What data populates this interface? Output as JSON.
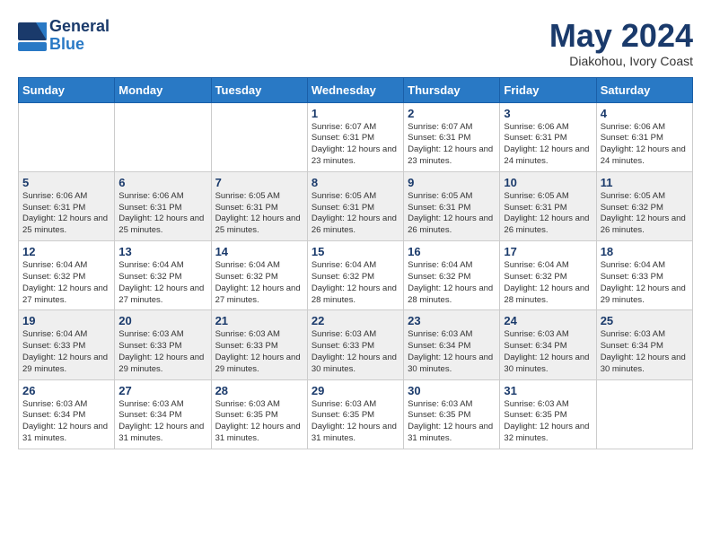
{
  "logo": {
    "general": "General",
    "blue": "Blue"
  },
  "title": {
    "month": "May 2024",
    "location": "Diakohou, Ivory Coast"
  },
  "weekdays": [
    "Sunday",
    "Monday",
    "Tuesday",
    "Wednesday",
    "Thursday",
    "Friday",
    "Saturday"
  ],
  "rows": [
    {
      "shaded": false,
      "cells": [
        {
          "day": "",
          "sunrise": "",
          "sunset": "",
          "daylight": ""
        },
        {
          "day": "",
          "sunrise": "",
          "sunset": "",
          "daylight": ""
        },
        {
          "day": "",
          "sunrise": "",
          "sunset": "",
          "daylight": ""
        },
        {
          "day": "1",
          "sunrise": "Sunrise: 6:07 AM",
          "sunset": "Sunset: 6:31 PM",
          "daylight": "Daylight: 12 hours and 23 minutes."
        },
        {
          "day": "2",
          "sunrise": "Sunrise: 6:07 AM",
          "sunset": "Sunset: 6:31 PM",
          "daylight": "Daylight: 12 hours and 23 minutes."
        },
        {
          "day": "3",
          "sunrise": "Sunrise: 6:06 AM",
          "sunset": "Sunset: 6:31 PM",
          "daylight": "Daylight: 12 hours and 24 minutes."
        },
        {
          "day": "4",
          "sunrise": "Sunrise: 6:06 AM",
          "sunset": "Sunset: 6:31 PM",
          "daylight": "Daylight: 12 hours and 24 minutes."
        }
      ]
    },
    {
      "shaded": true,
      "cells": [
        {
          "day": "5",
          "sunrise": "Sunrise: 6:06 AM",
          "sunset": "Sunset: 6:31 PM",
          "daylight": "Daylight: 12 hours and 25 minutes."
        },
        {
          "day": "6",
          "sunrise": "Sunrise: 6:06 AM",
          "sunset": "Sunset: 6:31 PM",
          "daylight": "Daylight: 12 hours and 25 minutes."
        },
        {
          "day": "7",
          "sunrise": "Sunrise: 6:05 AM",
          "sunset": "Sunset: 6:31 PM",
          "daylight": "Daylight: 12 hours and 25 minutes."
        },
        {
          "day": "8",
          "sunrise": "Sunrise: 6:05 AM",
          "sunset": "Sunset: 6:31 PM",
          "daylight": "Daylight: 12 hours and 26 minutes."
        },
        {
          "day": "9",
          "sunrise": "Sunrise: 6:05 AM",
          "sunset": "Sunset: 6:31 PM",
          "daylight": "Daylight: 12 hours and 26 minutes."
        },
        {
          "day": "10",
          "sunrise": "Sunrise: 6:05 AM",
          "sunset": "Sunset: 6:31 PM",
          "daylight": "Daylight: 12 hours and 26 minutes."
        },
        {
          "day": "11",
          "sunrise": "Sunrise: 6:05 AM",
          "sunset": "Sunset: 6:32 PM",
          "daylight": "Daylight: 12 hours and 26 minutes."
        }
      ]
    },
    {
      "shaded": false,
      "cells": [
        {
          "day": "12",
          "sunrise": "Sunrise: 6:04 AM",
          "sunset": "Sunset: 6:32 PM",
          "daylight": "Daylight: 12 hours and 27 minutes."
        },
        {
          "day": "13",
          "sunrise": "Sunrise: 6:04 AM",
          "sunset": "Sunset: 6:32 PM",
          "daylight": "Daylight: 12 hours and 27 minutes."
        },
        {
          "day": "14",
          "sunrise": "Sunrise: 6:04 AM",
          "sunset": "Sunset: 6:32 PM",
          "daylight": "Daylight: 12 hours and 27 minutes."
        },
        {
          "day": "15",
          "sunrise": "Sunrise: 6:04 AM",
          "sunset": "Sunset: 6:32 PM",
          "daylight": "Daylight: 12 hours and 28 minutes."
        },
        {
          "day": "16",
          "sunrise": "Sunrise: 6:04 AM",
          "sunset": "Sunset: 6:32 PM",
          "daylight": "Daylight: 12 hours and 28 minutes."
        },
        {
          "day": "17",
          "sunrise": "Sunrise: 6:04 AM",
          "sunset": "Sunset: 6:32 PM",
          "daylight": "Daylight: 12 hours and 28 minutes."
        },
        {
          "day": "18",
          "sunrise": "Sunrise: 6:04 AM",
          "sunset": "Sunset: 6:33 PM",
          "daylight": "Daylight: 12 hours and 29 minutes."
        }
      ]
    },
    {
      "shaded": true,
      "cells": [
        {
          "day": "19",
          "sunrise": "Sunrise: 6:04 AM",
          "sunset": "Sunset: 6:33 PM",
          "daylight": "Daylight: 12 hours and 29 minutes."
        },
        {
          "day": "20",
          "sunrise": "Sunrise: 6:03 AM",
          "sunset": "Sunset: 6:33 PM",
          "daylight": "Daylight: 12 hours and 29 minutes."
        },
        {
          "day": "21",
          "sunrise": "Sunrise: 6:03 AM",
          "sunset": "Sunset: 6:33 PM",
          "daylight": "Daylight: 12 hours and 29 minutes."
        },
        {
          "day": "22",
          "sunrise": "Sunrise: 6:03 AM",
          "sunset": "Sunset: 6:33 PM",
          "daylight": "Daylight: 12 hours and 30 minutes."
        },
        {
          "day": "23",
          "sunrise": "Sunrise: 6:03 AM",
          "sunset": "Sunset: 6:34 PM",
          "daylight": "Daylight: 12 hours and 30 minutes."
        },
        {
          "day": "24",
          "sunrise": "Sunrise: 6:03 AM",
          "sunset": "Sunset: 6:34 PM",
          "daylight": "Daylight: 12 hours and 30 minutes."
        },
        {
          "day": "25",
          "sunrise": "Sunrise: 6:03 AM",
          "sunset": "Sunset: 6:34 PM",
          "daylight": "Daylight: 12 hours and 30 minutes."
        }
      ]
    },
    {
      "shaded": false,
      "cells": [
        {
          "day": "26",
          "sunrise": "Sunrise: 6:03 AM",
          "sunset": "Sunset: 6:34 PM",
          "daylight": "Daylight: 12 hours and 31 minutes."
        },
        {
          "day": "27",
          "sunrise": "Sunrise: 6:03 AM",
          "sunset": "Sunset: 6:34 PM",
          "daylight": "Daylight: 12 hours and 31 minutes."
        },
        {
          "day": "28",
          "sunrise": "Sunrise: 6:03 AM",
          "sunset": "Sunset: 6:35 PM",
          "daylight": "Daylight: 12 hours and 31 minutes."
        },
        {
          "day": "29",
          "sunrise": "Sunrise: 6:03 AM",
          "sunset": "Sunset: 6:35 PM",
          "daylight": "Daylight: 12 hours and 31 minutes."
        },
        {
          "day": "30",
          "sunrise": "Sunrise: 6:03 AM",
          "sunset": "Sunset: 6:35 PM",
          "daylight": "Daylight: 12 hours and 31 minutes."
        },
        {
          "day": "31",
          "sunrise": "Sunrise: 6:03 AM",
          "sunset": "Sunset: 6:35 PM",
          "daylight": "Daylight: 12 hours and 32 minutes."
        },
        {
          "day": "",
          "sunrise": "",
          "sunset": "",
          "daylight": ""
        }
      ]
    }
  ]
}
